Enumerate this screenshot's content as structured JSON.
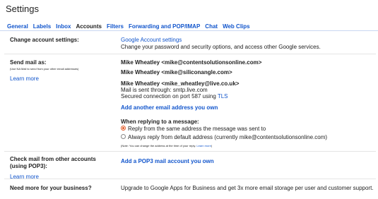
{
  "page": {
    "title": "Settings"
  },
  "tabs": [
    {
      "label": "General"
    },
    {
      "label": "Labels"
    },
    {
      "label": "Inbox"
    },
    {
      "label": "Accounts",
      "active": true
    },
    {
      "label": "Filters"
    },
    {
      "label": "Forwarding and POP/IMAP"
    },
    {
      "label": "Chat"
    },
    {
      "label": "Web Clips"
    }
  ],
  "change_account": {
    "label": "Change account settings:",
    "link": "Google Account settings",
    "desc": "Change your password and security options, and access other Google services."
  },
  "send_mail": {
    "label": "Send mail as:",
    "sublabel": "(Use NA Mail to send from your other email addresses)",
    "learn_more": "Learn more",
    "addresses": [
      "Mike Wheatley <mike@contentsolutionsonline.com>",
      "Mike Wheatley <mike@siliconangle.com>",
      "Mike Wheatley <mike_wheatley@live.co.uk>"
    ],
    "sent_through": "Mail is sent through: smtp.live.com",
    "secured_prefix": "Secured connection on port 587 using",
    "tls_link": "TLS",
    "add_link": "Add another email address you own",
    "reply_heading": "When replying to a message:",
    "reply_options": [
      "Reply from the same address the message was sent to",
      "Always reply from default address (currently mike@contentsolutionsonline.com)"
    ],
    "note": "(Note: You can change the address at the time of your reply.",
    "note_link": "Learn more",
    "note_end": ")"
  },
  "check_mail": {
    "label_line1": "Check mail from other accounts",
    "label_line2": "(using POP3):",
    "learn_more": "Learn more",
    "add_link": "Add a POP3 mail account you own"
  },
  "business": {
    "label": "Need more for your business?",
    "desc": "Upgrade to Google Apps for Business and get 3x more email storage per user and customer support."
  }
}
